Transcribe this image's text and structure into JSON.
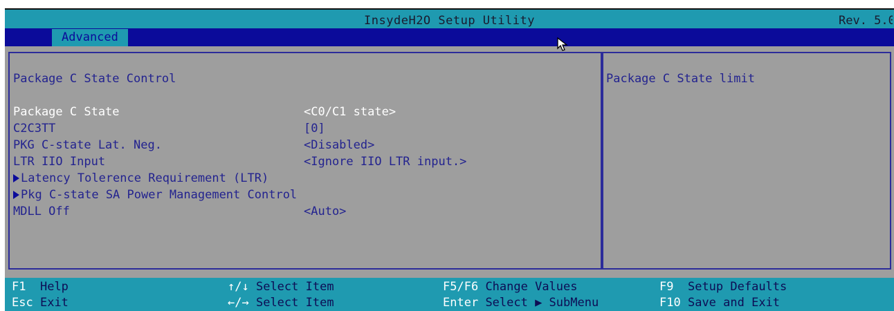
{
  "header": {
    "title": "InsydeH2O Setup Utility",
    "revision": "Rev. 5.0"
  },
  "tabs": [
    {
      "label": "Advanced",
      "active": true
    }
  ],
  "main": {
    "section_title": "Package C State Control",
    "rows": [
      {
        "label": "Package C State",
        "value": "<C0/C1 state>",
        "selected": true
      },
      {
        "label": "C2C3TT",
        "value": "[0]"
      },
      {
        "label": "PKG C-state Lat. Neg.",
        "value": "<Disabled>"
      },
      {
        "label": "LTR IIO Input",
        "value": "<Ignore IIO LTR input.>"
      },
      {
        "label": "Latency Tolerence Requirement (LTR)",
        "value": "",
        "submenu": true
      },
      {
        "label": "Pkg C-state SA Power Management Control",
        "value": "",
        "submenu": true
      },
      {
        "label": "MDLL Off",
        "value": "<Auto>"
      }
    ]
  },
  "help": {
    "text": "Package C State limit"
  },
  "footer": {
    "keys": [
      {
        "key": "F1",
        "desc": "Help"
      },
      {
        "key": "Esc",
        "desc": "Exit"
      },
      {
        "key": "↑/↓",
        "desc": "Select Item"
      },
      {
        "key": "←/→",
        "desc": "Select Item"
      },
      {
        "key": "F5/F6",
        "desc": "Change Values"
      },
      {
        "key": "Enter",
        "desc": "Select ▶ SubMenu"
      },
      {
        "key": "F9",
        "desc": "Setup Defaults"
      },
      {
        "key": "F10",
        "desc": "Save and Exit"
      }
    ]
  },
  "colors": {
    "background": "#9e9e9e",
    "title_bar": "#1f9ab0",
    "tab_bar": "#0b0b9a",
    "text_dark_blue": "#23238f",
    "selected_text": "#ffffff"
  },
  "icons": {
    "cursor": "mouse-pointer-icon",
    "submenu": "submenu-triangle-icon"
  }
}
